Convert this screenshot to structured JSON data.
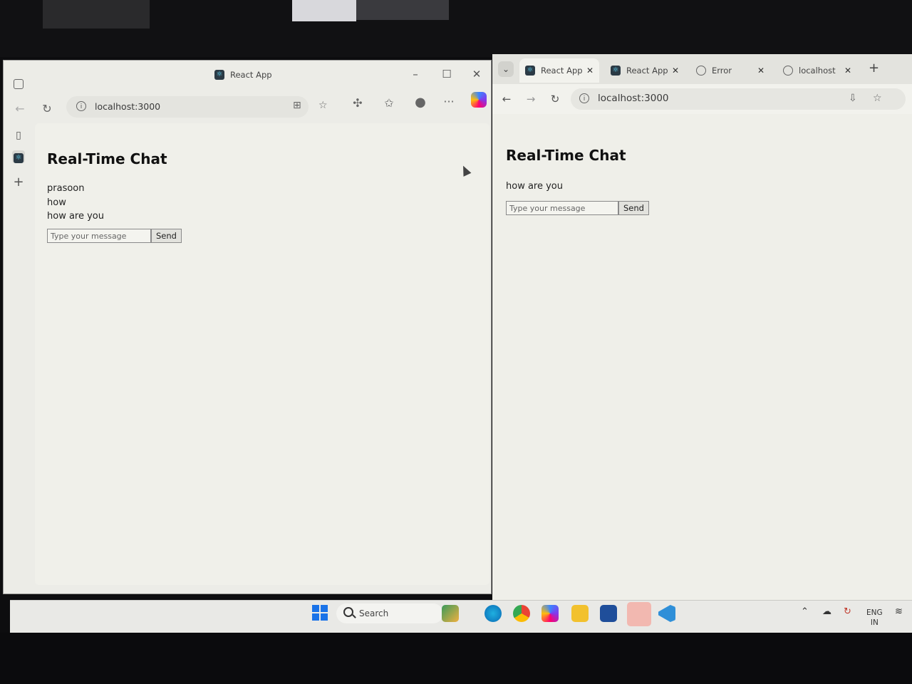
{
  "left_window": {
    "title": "React App",
    "url": "localhost:3000",
    "chat": {
      "heading": "Real-Time Chat",
      "messages": [
        "prasoon",
        "how",
        "how are you"
      ],
      "input_placeholder": "Type your message",
      "send_label": "Send"
    }
  },
  "right_window": {
    "tabs": [
      {
        "label": "React App",
        "active": true
      },
      {
        "label": "React App",
        "active": false
      },
      {
        "label": "Error",
        "active": false
      },
      {
        "label": "localhost",
        "active": false
      }
    ],
    "url": "localhost:3000",
    "chat": {
      "heading": "Real-Time Chat",
      "messages": [
        "how are you"
      ],
      "input_placeholder": "Type your message",
      "send_label": "Send"
    }
  },
  "taskbar": {
    "search_label": "Search",
    "lang_top": "ENG",
    "lang_bottom": "IN"
  },
  "colors": {
    "accent_blue": "#1a73e8",
    "page_bg": "#f0f0ea"
  }
}
